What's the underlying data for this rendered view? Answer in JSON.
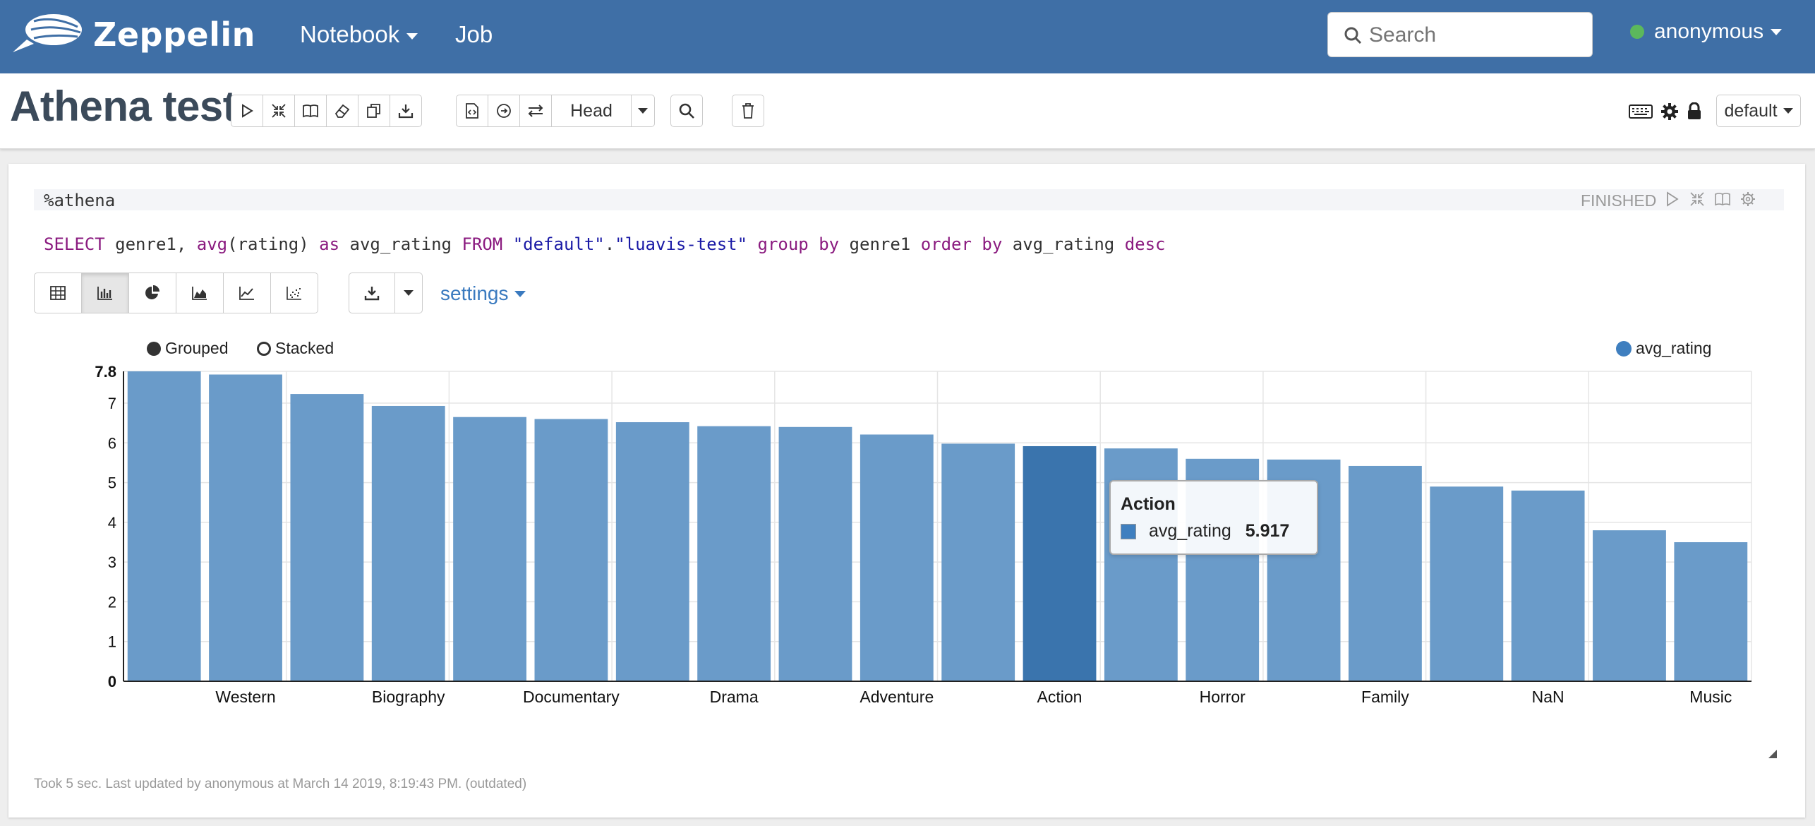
{
  "navbar": {
    "brand": "Zeppelin",
    "notebook_label": "Notebook",
    "job_label": "Job",
    "search_placeholder": "Search",
    "user": "anonymous",
    "colors": {
      "bar": "#3f6fa6",
      "status_online": "#5cb85c"
    }
  },
  "header": {
    "title": "Athena test",
    "head_label": "Head",
    "interpreter_label": "default"
  },
  "paragraph": {
    "interpreter_line": "%athena",
    "query_tokens": [
      {
        "t": "SELECT",
        "c": "kw"
      },
      {
        "t": " genre1, ",
        "c": "plain"
      },
      {
        "t": "avg",
        "c": "fn"
      },
      {
        "t": "(rating) ",
        "c": "plain"
      },
      {
        "t": "as",
        "c": "kw"
      },
      {
        "t": " avg_rating ",
        "c": "plain"
      },
      {
        "t": "FROM",
        "c": "kw"
      },
      {
        "t": " ",
        "c": "plain"
      },
      {
        "t": "\"default\"",
        "c": "str"
      },
      {
        "t": ".",
        "c": "plain"
      },
      {
        "t": "\"luavis-test\"",
        "c": "str"
      },
      {
        "t": " ",
        "c": "plain"
      },
      {
        "t": "group",
        "c": "kw"
      },
      {
        "t": " ",
        "c": "plain"
      },
      {
        "t": "by",
        "c": "kw"
      },
      {
        "t": " genre1 ",
        "c": "plain"
      },
      {
        "t": "order",
        "c": "kw"
      },
      {
        "t": " ",
        "c": "plain"
      },
      {
        "t": "by",
        "c": "kw"
      },
      {
        "t": " avg_rating ",
        "c": "plain"
      },
      {
        "t": "desc",
        "c": "kw"
      }
    ],
    "status": "FINISHED",
    "settings_label": "settings",
    "grouped_label": "Grouped",
    "stacked_label": "Stacked",
    "legend_label": "avg_rating",
    "footer": "Took 5 sec. Last updated by anonymous at March 14 2019, 8:19:43 PM. (outdated)"
  },
  "tooltip": {
    "title": "Action",
    "series": "avg_rating",
    "value": "5.917"
  },
  "chart_data": {
    "type": "bar",
    "series_name": "avg_rating",
    "values": [
      7.8,
      7.72,
      7.23,
      6.93,
      6.65,
      6.6,
      6.52,
      6.42,
      6.4,
      6.21,
      5.98,
      5.917,
      5.86,
      5.6,
      5.58,
      5.42,
      4.9,
      4.8,
      3.8,
      3.5
    ],
    "visible_x_labels": [
      "Western",
      "Biography",
      "Documentary",
      "Drama",
      "Adventure",
      "Action",
      "Horror",
      "Family",
      "NaN",
      "Music"
    ],
    "y_ticks": [
      "0",
      "1",
      "2",
      "3",
      "4",
      "5",
      "6",
      "7",
      "7.8"
    ],
    "ylim": [
      0,
      7.8
    ],
    "highlighted_label": "Action",
    "colors": {
      "bar": "#6a9bc9",
      "highlight": "#3a74ad",
      "grid": "#e5e5e5"
    }
  }
}
